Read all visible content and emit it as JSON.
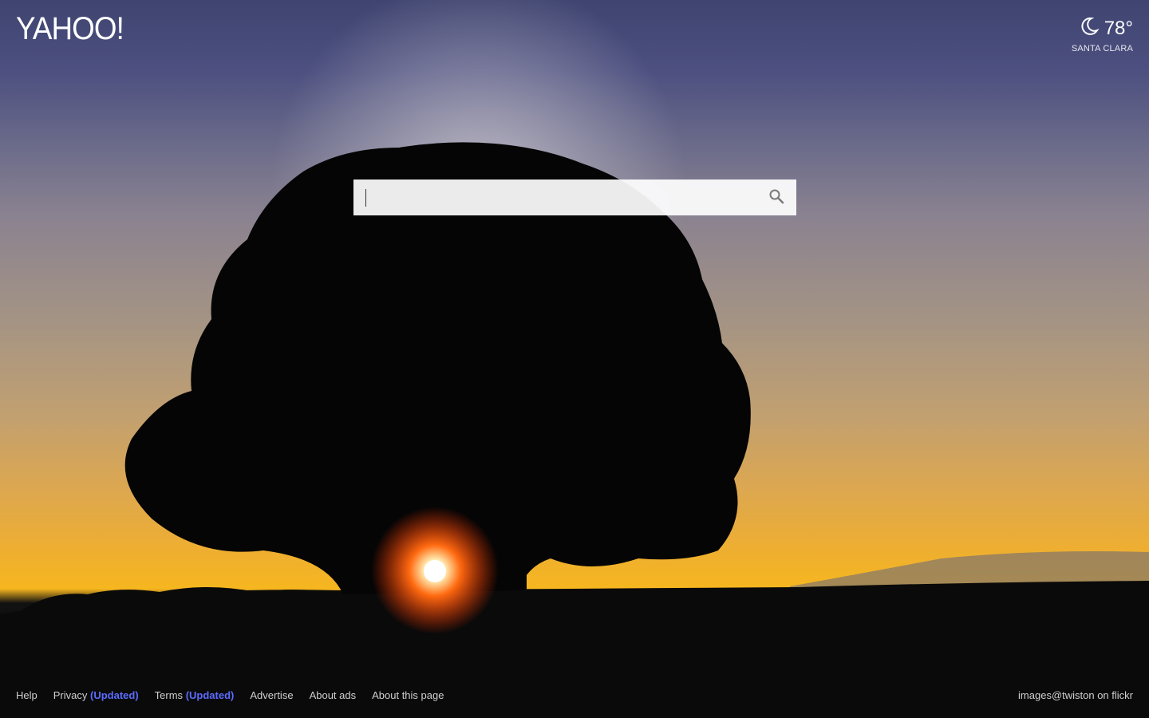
{
  "brand": {
    "logo_text": "YAHOO!"
  },
  "weather": {
    "icon": "moon-icon",
    "temperature": "78°",
    "location": "SANTA CLARA"
  },
  "search": {
    "value": "",
    "placeholder": "",
    "button_icon": "search-icon"
  },
  "footer": {
    "help": "Help",
    "privacy": "Privacy",
    "privacy_updated": "(Updated)",
    "terms": "Terms",
    "terms_updated": "(Updated)",
    "advertise": "Advertise",
    "about_ads": "About ads",
    "about_page": "About this page",
    "credit": "images@twiston on flickr"
  },
  "colors": {
    "updated_link": "#5b6cff",
    "footer_text": "#cfcfcf",
    "sky_top": "#3f4470",
    "sunset": "#f6b61f"
  }
}
